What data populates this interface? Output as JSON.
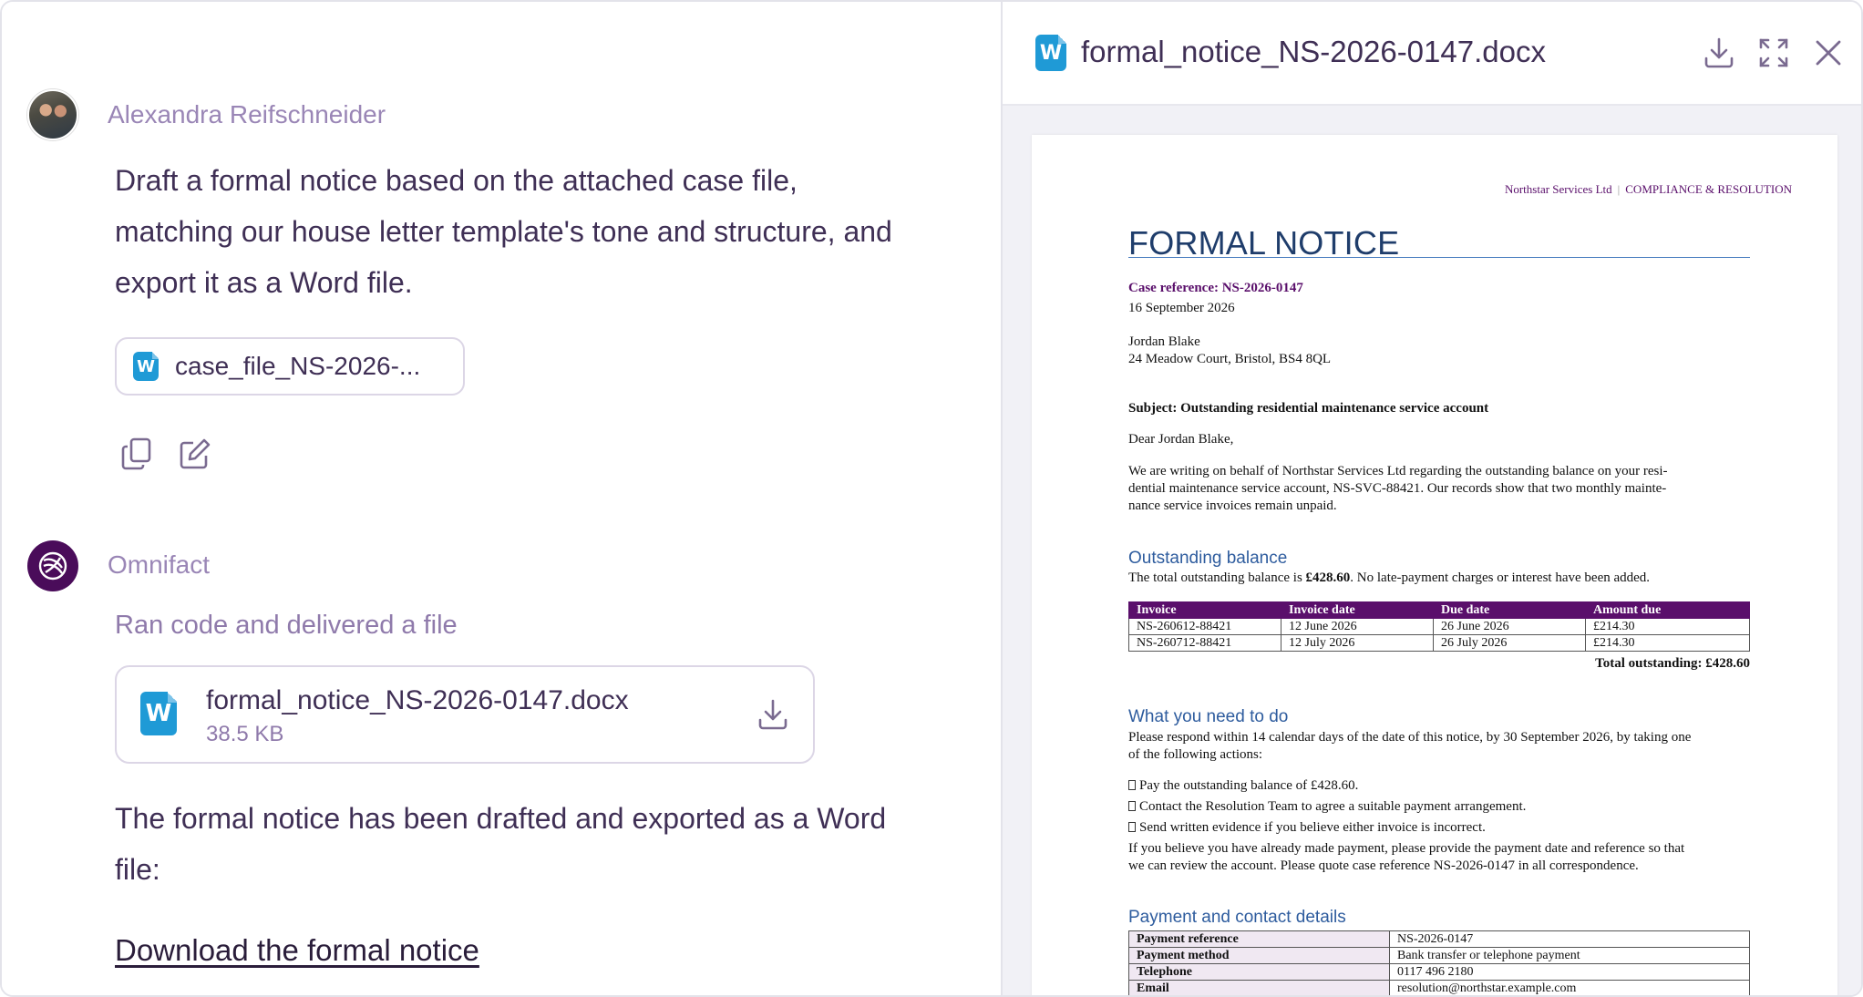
{
  "chat": {
    "user": {
      "name": "Alexandra Reifschneider",
      "message_lines": [
        "Draft a formal notice based on the attached case file,",
        "matching our house letter template's tone and structure, and",
        "export it as a Word file."
      ],
      "attachment": {
        "label": "case_file_NS-2026-...",
        "icon": "word-icon"
      },
      "actions": [
        "copy-icon",
        "edit-icon"
      ]
    },
    "assistant": {
      "name": "Omnifact",
      "status": "Ran code and delivered a file",
      "file": {
        "name": "formal_notice_NS-2026-0147.docx",
        "size": "38.5 KB",
        "icon": "word-icon"
      },
      "reply_lines": [
        "The formal notice has been drafted and exported as a Word",
        "file:"
      ],
      "download_link": "Download the formal notice"
    }
  },
  "preview": {
    "title": "formal_notice_NS-2026-0147.docx",
    "header_buttons": [
      "download-icon",
      "fullscreen-icon",
      "close-icon"
    ],
    "document": {
      "header_company": "Northstar Services Ltd",
      "header_dept": "COMPLIANCE & RESOLUTION",
      "title": "FORMAL NOTICE",
      "case_reference": "Case reference: NS-2026-0147",
      "date": "16 September 2026",
      "recipient_name": "Jordan Blake",
      "recipient_address": "24 Meadow Court, Bristol, BS4 8QL",
      "subject": "Subject: Outstanding residential maintenance service account",
      "salutation": "Dear Jordan Blake,",
      "intro_lines": [
        "We are writing on behalf of Northstar Services Ltd regarding the outstanding balance on your resi-",
        "dential maintenance service account, NS-SVC-88421. Our records show that two monthly mainte-",
        "nance service invoices remain unpaid."
      ],
      "balance_heading": "Outstanding balance",
      "balance_text_pre": "The total outstanding balance is ",
      "balance_amount": "£428.60",
      "balance_text_post": ". No late-payment charges or interest have been added.",
      "invoice_table": {
        "headers": [
          "Invoice",
          "Invoice date",
          "Due date",
          "Amount due"
        ],
        "rows": [
          [
            "NS-260612-88421",
            "12 June 2026",
            "26 June 2026",
            "£214.30"
          ],
          [
            "NS-260712-88421",
            "12 July 2026",
            "26 July 2026",
            "£214.30"
          ]
        ]
      },
      "total_outstanding": "Total outstanding: £428.60",
      "todo_heading": "What you need to do",
      "todo_intro_lines": [
        "Please respond within 14 calendar days of the date of this notice, by 30 September 2026, by taking one",
        "of the following actions:"
      ],
      "todo_items": [
        "Pay the outstanding balance of £428.60.",
        "Contact the Resolution Team to agree a suitable payment arrangement.",
        "Send written evidence if you believe either invoice is incorrect."
      ],
      "todo_outro_lines": [
        "If you believe you have already made payment, please provide the payment date and reference so that",
        "we can review the account. Please quote case reference NS-2026-0147 in all correspondence."
      ],
      "payment_heading": "Payment and contact details",
      "payment_table": [
        [
          "Payment reference",
          "NS-2026-0147"
        ],
        [
          "Payment method",
          "Bank transfer or telephone payment"
        ],
        [
          "Telephone",
          "0117 496 2180"
        ],
        [
          "Email",
          "resolution@northstar.example.com"
        ]
      ]
    }
  },
  "colors": {
    "accent_purple": "#5a0f6b",
    "heading_blue": "#2e5c9e",
    "word_blue": "#1f9ad6",
    "sender_lilac": "#9a86b6"
  }
}
